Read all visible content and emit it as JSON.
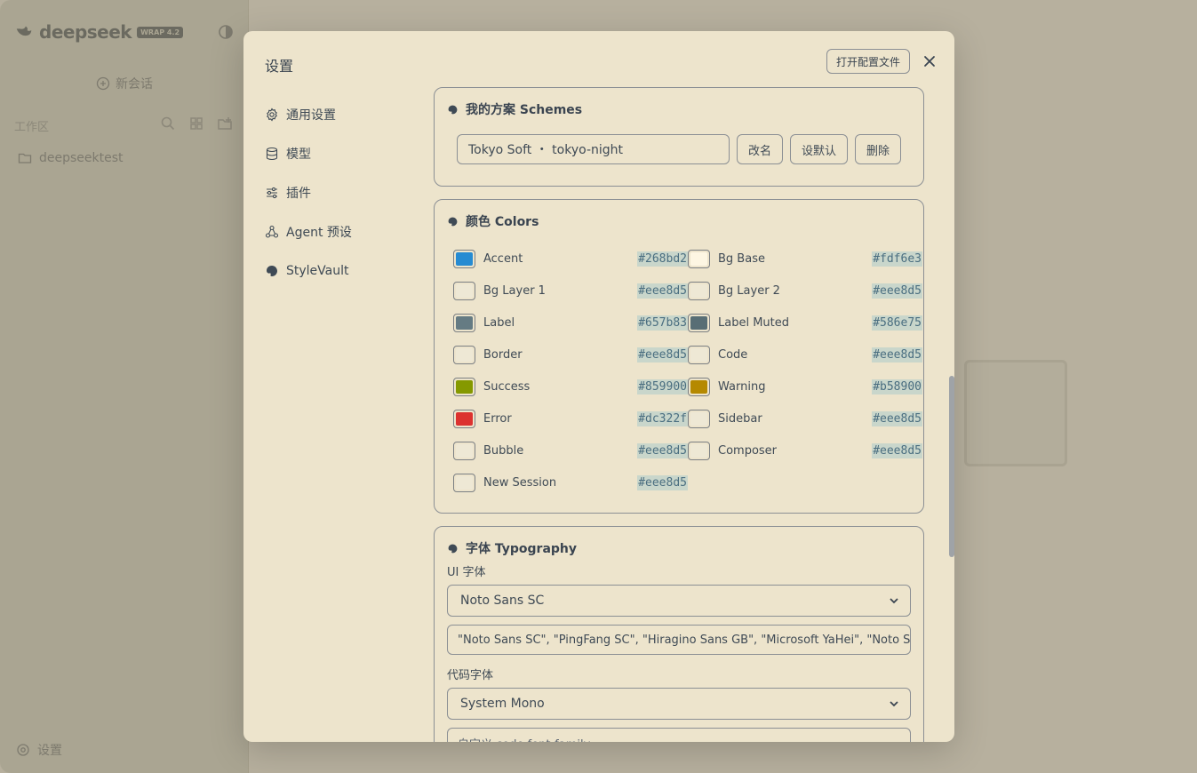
{
  "background": {
    "brand": {
      "name": "deepseek",
      "badge": "WRAP 4.2"
    },
    "new_session": "新会话",
    "workspace_label": "工作区",
    "folder": "deepseektest",
    "settings": "设置"
  },
  "modal": {
    "title": "设置",
    "open_config": "打开配置文件",
    "nav": [
      {
        "label": "通用设置",
        "icon": "gear-icon"
      },
      {
        "label": "模型",
        "icon": "database-icon"
      },
      {
        "label": "插件",
        "icon": "sliders-icon"
      },
      {
        "label": "Agent 预设",
        "icon": "agent-icon"
      },
      {
        "label": "StyleVault",
        "icon": "palette-icon"
      }
    ],
    "schemes": {
      "title": "我的方案 Schemes",
      "current": "Tokyo Soft ・ tokyo-night",
      "rename": "改名",
      "set_default": "设默认",
      "delete": "删除"
    },
    "colors": {
      "title": "颜色 Colors",
      "items": [
        {
          "name": "Accent",
          "hex": "#268bd2",
          "swatch": "#268bd2"
        },
        {
          "name": "Bg Base",
          "hex": "#fdf6e3",
          "swatch": "#fdf6e3"
        },
        {
          "name": "Bg Layer 1",
          "hex": "#eee8d5",
          "swatch": "#eee8d5"
        },
        {
          "name": "Bg Layer 2",
          "hex": "#eee8d5",
          "swatch": "#eee8d5"
        },
        {
          "name": "Label",
          "hex": "#657b83",
          "swatch": "#657b83"
        },
        {
          "name": "Label Muted",
          "hex": "#586e75",
          "swatch": "#586e75"
        },
        {
          "name": "Border",
          "hex": "#eee8d5",
          "swatch": "#eee8d5"
        },
        {
          "name": "Code",
          "hex": "#eee8d5",
          "swatch": "#eee8d5"
        },
        {
          "name": "Success",
          "hex": "#859900",
          "swatch": "#859900"
        },
        {
          "name": "Warning",
          "hex": "#b58900",
          "swatch": "#b58900"
        },
        {
          "name": "Error",
          "hex": "#dc322f",
          "swatch": "#dc322f"
        },
        {
          "name": "Sidebar",
          "hex": "#eee8d5",
          "swatch": "#eee8d5"
        },
        {
          "name": "Bubble",
          "hex": "#eee8d5",
          "swatch": "#eee8d5"
        },
        {
          "name": "Composer",
          "hex": "#eee8d5",
          "swatch": "#eee8d5"
        },
        {
          "name": "New Session",
          "hex": "#eee8d5",
          "swatch": "#eee8d5"
        }
      ]
    },
    "typography": {
      "title": "字体 Typography",
      "ui_label": "UI 字体",
      "ui_font": "Noto Sans SC",
      "ui_stack": "\"Noto Sans SC\", \"PingFang SC\", \"Hiragino Sans GB\", \"Microsoft YaHei\", \"Noto Sans SC\"",
      "code_label": "代码字体",
      "code_font": "System Mono",
      "code_placeholder": "自定义 code font-family…"
    }
  }
}
